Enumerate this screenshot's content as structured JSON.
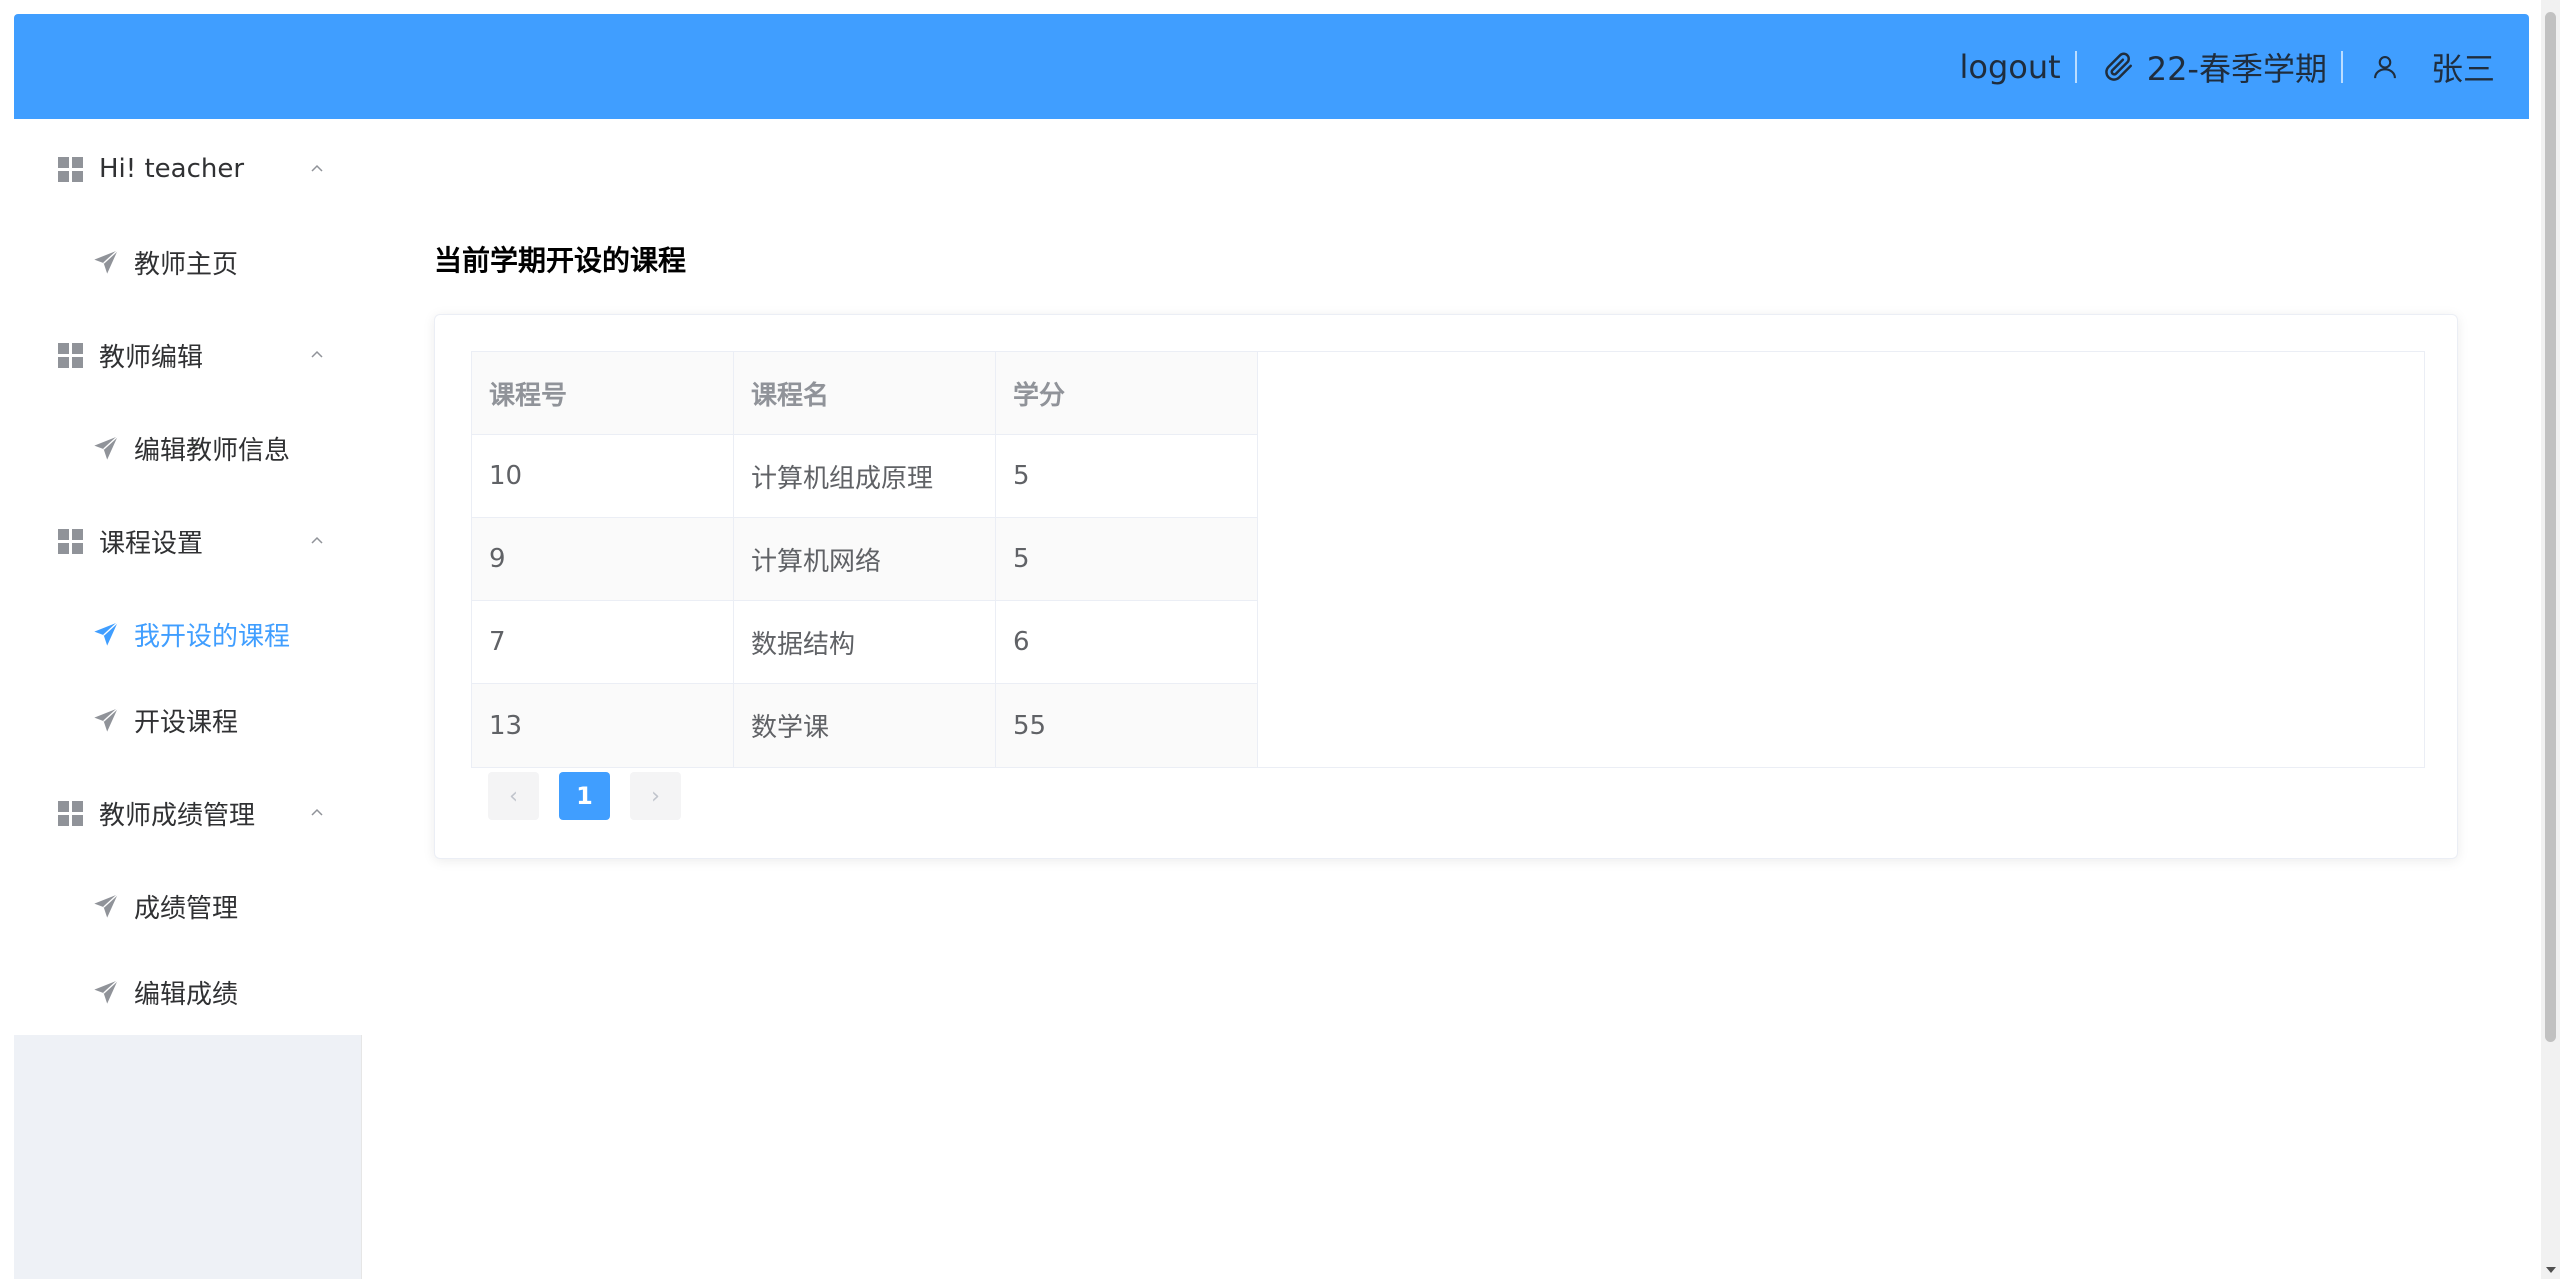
{
  "header": {
    "logout_label": "logout",
    "semester": "22-春季学期",
    "username": "张三",
    "icons": [
      "paperclip-icon",
      "user-icon"
    ]
  },
  "sidebar": {
    "groups": [
      {
        "title": "Hi! teacher",
        "items": [
          {
            "label": "教师主页"
          }
        ]
      },
      {
        "title": "教师编辑",
        "items": [
          {
            "label": "编辑教师信息"
          }
        ]
      },
      {
        "title": "课程设置",
        "items": [
          {
            "label": "我开设的课程",
            "active": true
          },
          {
            "label": "开设课程"
          }
        ]
      },
      {
        "title": "教师成绩管理",
        "items": [
          {
            "label": "成绩管理"
          },
          {
            "label": "编辑成绩"
          }
        ]
      }
    ]
  },
  "main": {
    "section_title": "当前学期开设的课程",
    "table": {
      "columns": [
        "课程号",
        "课程名",
        "学分"
      ],
      "rows": [
        [
          "10",
          "计算机组成原理",
          "5"
        ],
        [
          "9",
          "计算机网络",
          "5"
        ],
        [
          "7",
          "数据结构",
          "6"
        ],
        [
          "13",
          "数学课",
          "55"
        ]
      ]
    },
    "pagination": {
      "prev": "‹",
      "current_page": "1",
      "next": "›"
    }
  },
  "colors": {
    "primary": "#409eff",
    "sidebar_bg": "#eef1f6",
    "text": "#303133"
  }
}
